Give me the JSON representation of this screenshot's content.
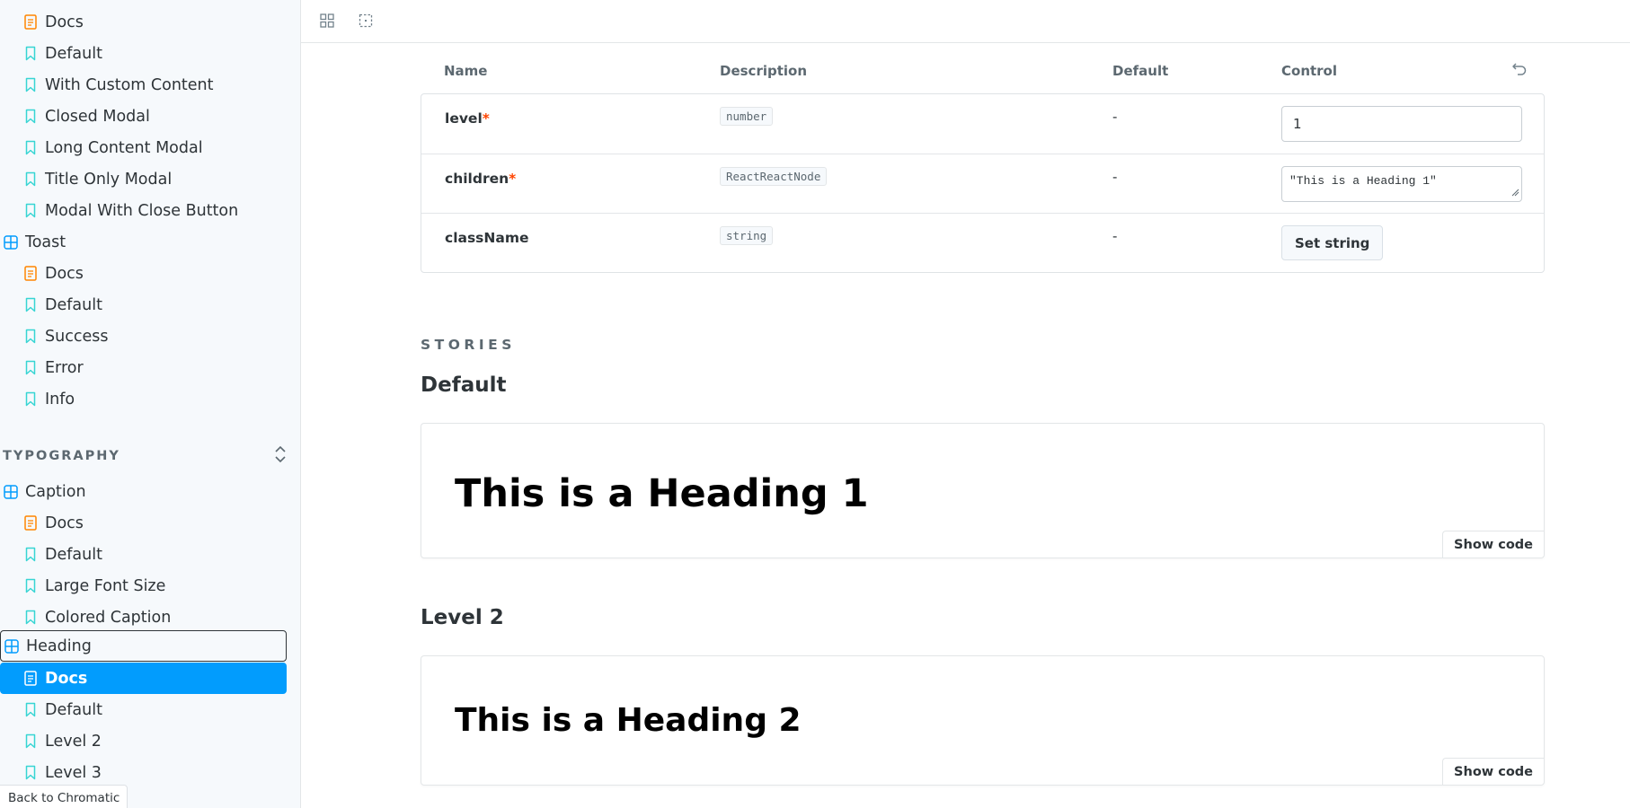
{
  "sidebar": {
    "items_top": [
      {
        "label": "Docs",
        "kind": "docs"
      },
      {
        "label": "Default",
        "kind": "story"
      },
      {
        "label": "With Custom Content",
        "kind": "story"
      },
      {
        "label": "Closed Modal",
        "kind": "story"
      },
      {
        "label": "Long Content Modal",
        "kind": "story"
      },
      {
        "label": "Title Only Modal",
        "kind": "story"
      },
      {
        "label": "Modal With Close Button",
        "kind": "story"
      },
      {
        "label": "Toast",
        "kind": "component"
      },
      {
        "label": "Docs",
        "kind": "docs"
      },
      {
        "label": "Default",
        "kind": "story"
      },
      {
        "label": "Success",
        "kind": "story"
      },
      {
        "label": "Error",
        "kind": "story"
      },
      {
        "label": "Info",
        "kind": "story"
      }
    ],
    "section_title": "TYPOGRAPHY",
    "items_typography": [
      {
        "label": "Caption",
        "kind": "component"
      },
      {
        "label": "Docs",
        "kind": "docs"
      },
      {
        "label": "Default",
        "kind": "story"
      },
      {
        "label": "Large Font Size",
        "kind": "story"
      },
      {
        "label": "Colored Caption",
        "kind": "story"
      },
      {
        "label": "Heading",
        "kind": "component",
        "state": "focused"
      },
      {
        "label": "Docs",
        "kind": "docs",
        "state": "selected"
      },
      {
        "label": "Default",
        "kind": "story"
      },
      {
        "label": "Level 2",
        "kind": "story"
      },
      {
        "label": "Level 3",
        "kind": "story"
      }
    ],
    "back_button": "Back to Chromatic"
  },
  "args_table": {
    "headers": {
      "name": "Name",
      "description": "Description",
      "default": "Default",
      "control": "Control"
    },
    "rows": [
      {
        "name": "level",
        "required": "*",
        "type": "number",
        "default": "-",
        "control_value": "1"
      },
      {
        "name": "children",
        "required": "*",
        "type": "ReactReactNode",
        "default": "-",
        "control_value": "\"This is a Heading 1\""
      },
      {
        "name": "className",
        "required": "",
        "type": "string",
        "default": "-",
        "control_value": "Set string"
      }
    ]
  },
  "stories": {
    "section_title": "STORIES",
    "items": [
      {
        "title": "Default",
        "preview_text": "This is a Heading 1",
        "show_code": "Show code"
      },
      {
        "title": "Level 2",
        "preview_text": "This is a Heading 2",
        "show_code": "Show code"
      }
    ]
  },
  "colors": {
    "accent": "#029cfd",
    "component_icon": "#029cfd",
    "docs_icon": "#ff8500",
    "story_icon": "#37d5d3",
    "required": "#ff4400"
  }
}
